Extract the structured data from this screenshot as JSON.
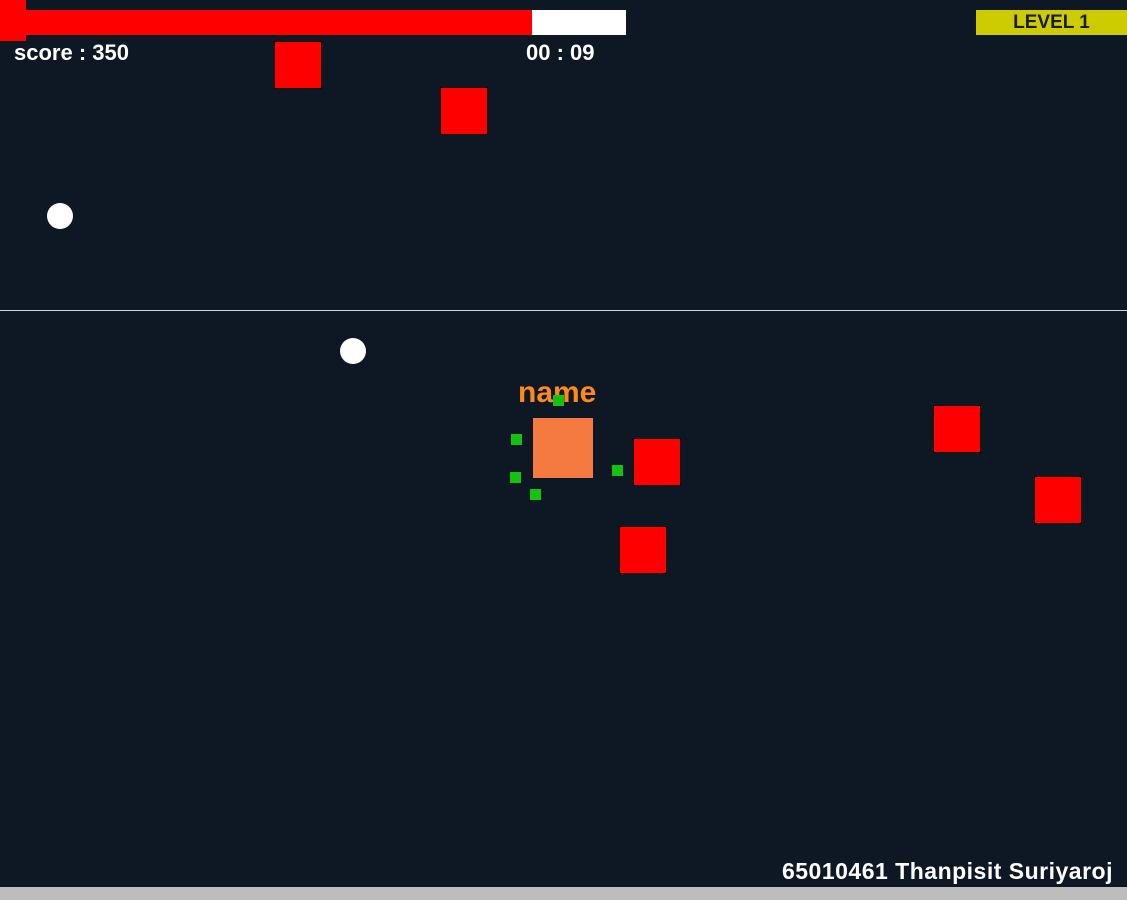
{
  "hud": {
    "health": {
      "fraction": 0.85,
      "fill_color": "#ff0000",
      "track_color": "#ffffff"
    },
    "score_text": "score : 350",
    "timer_text": "00 : 09",
    "level_text": "LEVEL 1",
    "level_color": "#cccc00"
  },
  "player": {
    "name": "name",
    "color": "#f47a40"
  },
  "footer": {
    "credit": "65010461 Thanpisit Suriyaroj"
  },
  "colors": {
    "background": "#0e1824",
    "enemy": "#ff0000",
    "orb": "#ffffff",
    "particle": "#14c214",
    "name_label": "#ff8a1c"
  }
}
